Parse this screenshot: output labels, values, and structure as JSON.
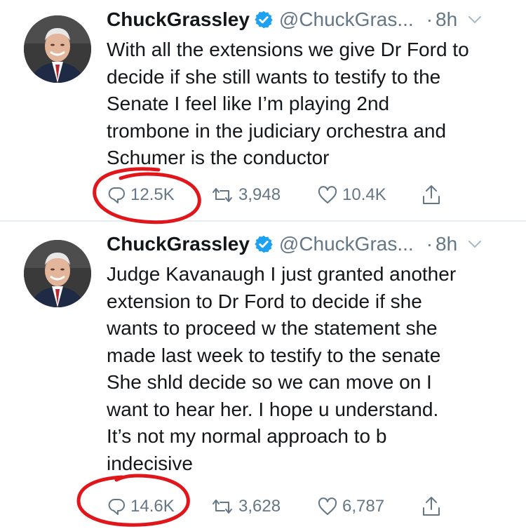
{
  "tweets": [
    {
      "name": "ChuckGrassley",
      "handle": "@ChuckGras...",
      "separator": "·",
      "time": "8h",
      "text": "With all the extensions we give Dr Ford to\ndecide if she still wants to testify to the\nSenate I feel like I’m playing 2nd\ntrombone in the judiciary orchestra and\nSchumer is the conductor",
      "replies": "12.5K",
      "retweets": "3,948",
      "likes": "10.4K"
    },
    {
      "name": "ChuckGrassley",
      "handle": "@ChuckGras...",
      "separator": "·",
      "time": "8h",
      "text": "Judge Kavanaugh I just granted another\nextension to Dr Ford to decide if she\nwants to proceed w the statement she\nmade last week to testify to the senate\nShe shld decide so we can move on  I\nwant to hear her.  I hope u understand.\nIt’s not my normal approach to b\nindecisive",
      "replies": "14.6K",
      "retweets": "3,628",
      "likes": "6,787"
    }
  ],
  "colors": {
    "text": "#14171a",
    "muted": "#657786",
    "verified": "#1da1f2",
    "annotation": "#e0161b",
    "divider": "#e6ecf0"
  },
  "icons": {
    "verified": "verified-badge-icon",
    "chevron": "chevron-down-icon",
    "reply": "reply-icon",
    "retweet": "retweet-icon",
    "like": "heart-icon",
    "share": "share-icon"
  },
  "annotations": [
    "red-circle-around-reply-count",
    "red-circle-around-reply-count"
  ]
}
